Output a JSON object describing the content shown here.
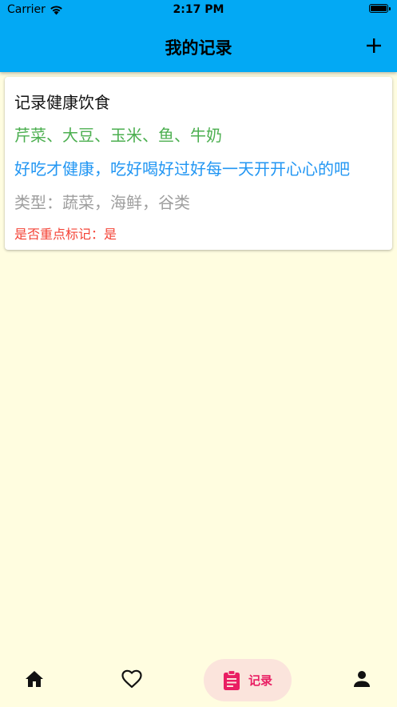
{
  "status_bar": {
    "carrier": "Carrier",
    "time": "2:17 PM"
  },
  "app_bar": {
    "title": "我的记录",
    "color": "#03A9F4"
  },
  "record": {
    "title": "记录健康饮食",
    "ingredients": "芹菜、大豆、玉米、鱼、牛奶",
    "description": "好吃才健康，吃好喝好过好每一天开开心心的吧",
    "type": "类型：蔬菜，海鲜，谷类",
    "is_key": "是否重点标记：是"
  },
  "bottom_nav": {
    "items": [
      {
        "icon": "home-icon"
      },
      {
        "icon": "heart-icon"
      },
      {
        "icon": "clipboard-icon",
        "label": "记录",
        "active": true
      },
      {
        "icon": "person-icon"
      }
    ],
    "accent": "#E91E63"
  }
}
